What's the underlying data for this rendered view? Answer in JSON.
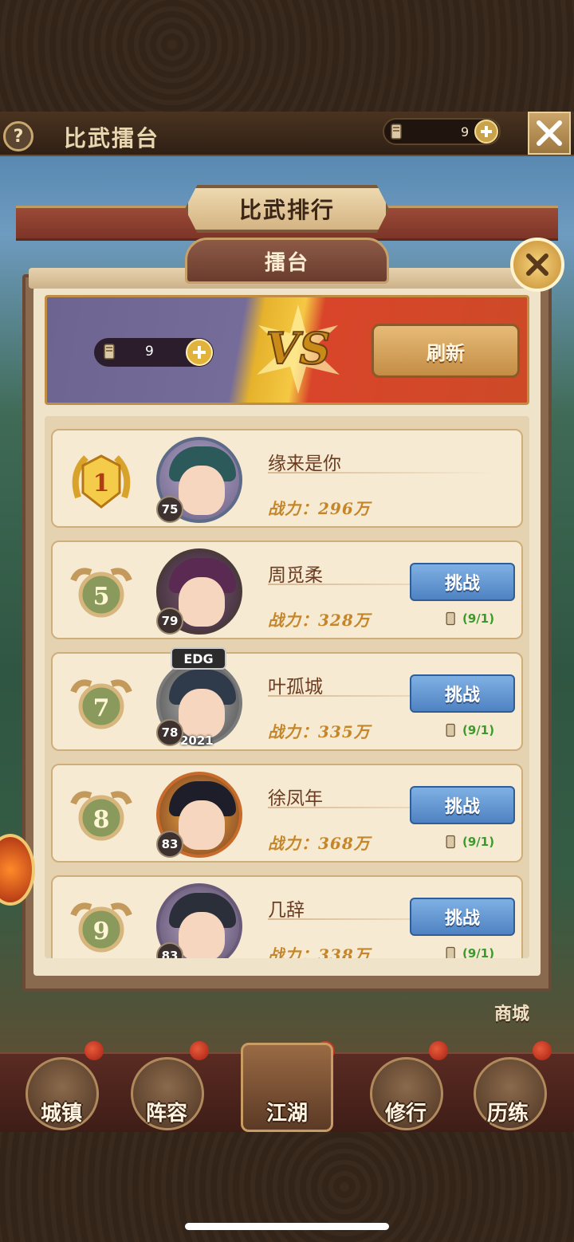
{
  "header": {
    "help_symbol": "?",
    "title": "比武擂台",
    "resource_value": "9",
    "resource_icon": "scroll-ticket-icon"
  },
  "ribbon": {
    "title": "比武排行"
  },
  "panel": {
    "tab_title": "擂台",
    "vs_text": "VS",
    "resource_value": "9",
    "refresh_label": "刷新"
  },
  "rows": [
    {
      "rank": "1",
      "level": "75",
      "name": "缘来是你",
      "power": "战力：296万",
      "challenge": "",
      "tickets": ""
    },
    {
      "rank": "5",
      "level": "79",
      "name": "周觅柔",
      "power": "战力：328万",
      "challenge": "挑战",
      "tickets": "(9/1)"
    },
    {
      "rank": "7",
      "level": "78",
      "name": "叶孤城",
      "power": "战力：335万",
      "challenge": "挑战",
      "tickets": "(9/1)",
      "frame_top": "EDG",
      "frame_bottom": "2021"
    },
    {
      "rank": "8",
      "level": "83",
      "name": "徐凤年",
      "power": "战力：368万",
      "challenge": "挑战",
      "tickets": "(9/1)"
    },
    {
      "rank": "9",
      "level": "83",
      "name": "几辞",
      "power": "战力：338万",
      "challenge": "挑战",
      "tickets": "(9/1)"
    }
  ],
  "nav": {
    "town": "城镇",
    "lineup": "阵容",
    "jianghu": "江湖",
    "cultivate": "修行",
    "train": "历练",
    "shop": "商城"
  },
  "colors": {
    "gold": "#c5862a",
    "challenge_blue": "#4f82c2",
    "ticket_green": "#3b9b2a"
  }
}
